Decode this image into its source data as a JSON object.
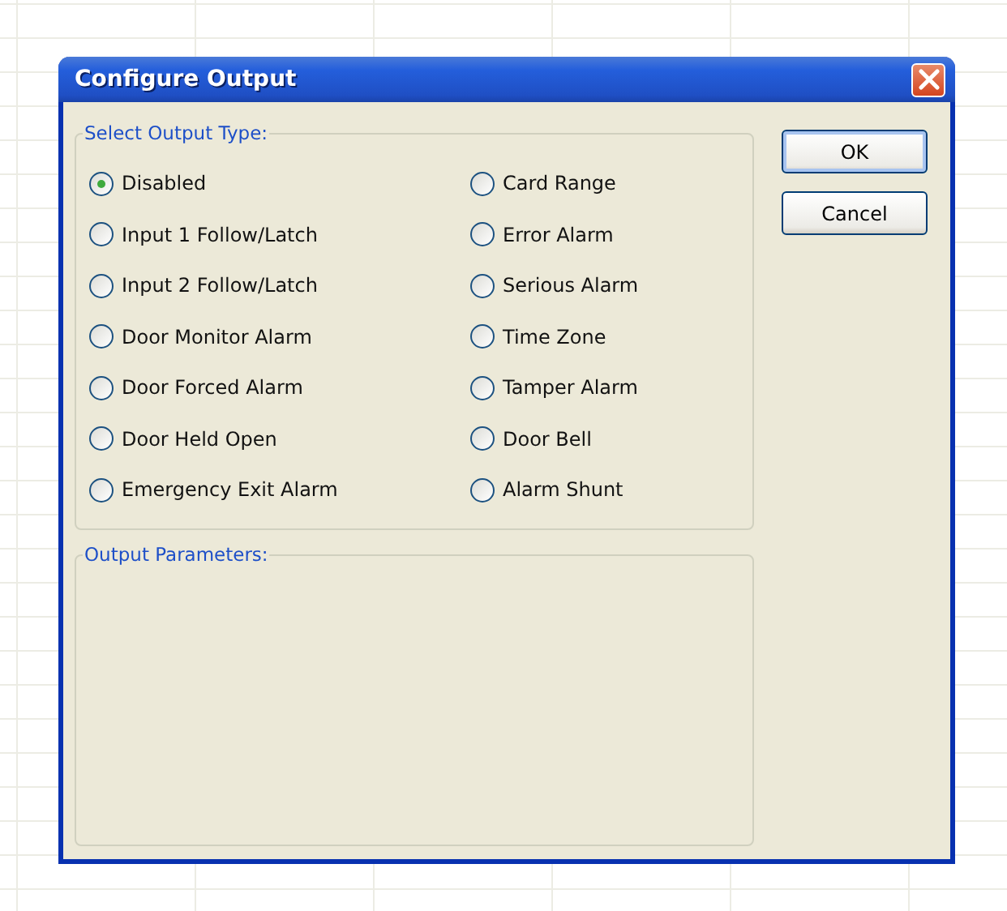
{
  "window": {
    "title": "Configure Output"
  },
  "output_type": {
    "legend": "Select Output Type:",
    "options": [
      {
        "label": "Disabled",
        "selected": true
      },
      {
        "label": "Card Range",
        "selected": false
      },
      {
        "label": "Input 1 Follow/Latch",
        "selected": false
      },
      {
        "label": "Error Alarm",
        "selected": false
      },
      {
        "label": "Input 2 Follow/Latch",
        "selected": false
      },
      {
        "label": "Serious Alarm",
        "selected": false
      },
      {
        "label": "Door Monitor Alarm",
        "selected": false
      },
      {
        "label": "Time Zone",
        "selected": false
      },
      {
        "label": "Door Forced Alarm",
        "selected": false
      },
      {
        "label": "Tamper Alarm",
        "selected": false
      },
      {
        "label": "Door Held Open",
        "selected": false
      },
      {
        "label": "Door Bell",
        "selected": false
      },
      {
        "label": "Emergency Exit Alarm",
        "selected": false
      },
      {
        "label": "Alarm Shunt",
        "selected": false
      }
    ]
  },
  "output_parameters": {
    "legend": "Output Parameters:"
  },
  "buttons": [
    "OK",
    "Cancel"
  ]
}
